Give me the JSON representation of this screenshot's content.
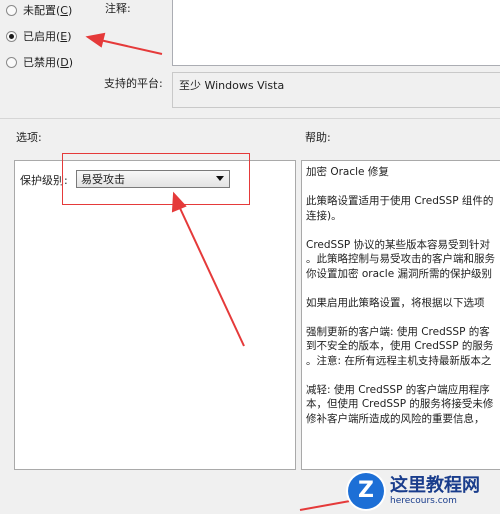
{
  "state": {
    "options": [
      {
        "label": "未配置(",
        "key": "C",
        "tail": ")",
        "checked": false
      },
      {
        "label": "已启用(",
        "key": "E",
        "tail": ")",
        "checked": true
      },
      {
        "label": "已禁用(",
        "key": "D",
        "tail": ")",
        "checked": false
      }
    ]
  },
  "comment": {
    "label": "注释:"
  },
  "platform": {
    "label": "支持的平台:",
    "value": "至少 Windows Vista"
  },
  "sections": {
    "options_label": "选项:",
    "help_label": "帮助:"
  },
  "protection": {
    "label": "保护级别:",
    "selected": "易受攻击"
  },
  "help": {
    "lines": [
      "加密 Oracle 修复",
      "",
      "此策略设置适用于使用 CredSSP 组件的",
      "连接)。",
      "",
      "CredSSP 协议的某些版本容易受到针对",
      "。此策略控制与易受攻击的客户端和服务",
      "你设置加密 oracle 漏洞所需的保护级别",
      "",
      "如果启用此策略设置，将根据以下选项",
      "",
      "强制更新的客户端: 使用 CredSSP 的客",
      "到不安全的版本，使用 CredSSP 的服务",
      "。注意: 在所有远程主机支持最新版本之",
      "",
      "减轻: 使用 CredSSP 的客户端应用程序",
      "本，但使用 CredSSP 的服务将接受未修",
      "修补客户端所造成的风险的重要信息，"
    ]
  },
  "watermark": {
    "logo_letter": "Z",
    "title": "这里教程网",
    "url": "herecours.com"
  },
  "colors": {
    "annotation_red": "#e53a3a",
    "watermark_blue": "#1d6fd6"
  }
}
